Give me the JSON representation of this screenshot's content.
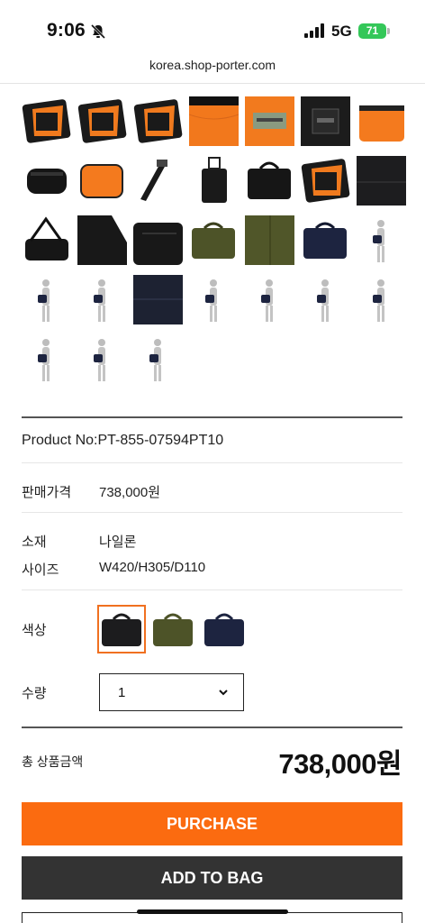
{
  "status_bar": {
    "time": "9:06",
    "network": "5G",
    "battery": "71"
  },
  "browser": {
    "url": "korea.shop-porter.com"
  },
  "gallery": {
    "thumbnails": [
      {
        "name": "thumb-black-open",
        "kind": "black-orange"
      },
      {
        "name": "thumb-black-side",
        "kind": "black-orange"
      },
      {
        "name": "thumb-black-open-2",
        "kind": "black-orange"
      },
      {
        "name": "thumb-orange-lining",
        "kind": "orange"
      },
      {
        "name": "thumb-label",
        "kind": "label"
      },
      {
        "name": "thumb-logo-patch",
        "kind": "patch"
      },
      {
        "name": "thumb-orange-case",
        "kind": "orange-case"
      },
      {
        "name": "thumb-black-pouch",
        "kind": "black-pouch"
      },
      {
        "name": "thumb-orange-pad",
        "kind": "orange-pad"
      },
      {
        "name": "thumb-strap",
        "kind": "strap"
      },
      {
        "name": "thumb-trolley",
        "kind": "trolley"
      },
      {
        "name": "thumb-black-front",
        "kind": "black-bag"
      },
      {
        "name": "thumb-black-inside",
        "kind": "black-orange"
      },
      {
        "name": "thumb-black-fabric",
        "kind": "black-fabric"
      },
      {
        "name": "thumb-black-strap",
        "kind": "black-strap"
      },
      {
        "name": "thumb-black-corner",
        "kind": "black-corner"
      },
      {
        "name": "thumb-black-zip",
        "kind": "black-zip"
      },
      {
        "name": "thumb-olive-front",
        "kind": "olive-bag"
      },
      {
        "name": "thumb-olive-fabric",
        "kind": "olive-fabric"
      },
      {
        "name": "thumb-navy-front",
        "kind": "navy-bag"
      },
      {
        "name": "thumb-model-1",
        "kind": "model"
      },
      {
        "name": "thumb-model-2",
        "kind": "model"
      },
      {
        "name": "thumb-model-3",
        "kind": "model"
      },
      {
        "name": "thumb-navy-fabric",
        "kind": "navy-fabric"
      },
      {
        "name": "thumb-model-4",
        "kind": "model"
      },
      {
        "name": "thumb-model-5",
        "kind": "model"
      },
      {
        "name": "thumb-model-6",
        "kind": "model"
      },
      {
        "name": "thumb-model-7",
        "kind": "model"
      },
      {
        "name": "thumb-model-8",
        "kind": "model"
      },
      {
        "name": "thumb-model-9",
        "kind": "model"
      },
      {
        "name": "thumb-model-10",
        "kind": "model"
      }
    ]
  },
  "product": {
    "product_no": "Product No:PT-855-07594PT10",
    "price_label": "판매가격",
    "price_value": "738,000원",
    "material_label": "소재",
    "material_value": "나일론",
    "size_label": "사이즈",
    "size_value": "W420/H305/D110",
    "color_label": "색상",
    "colors": [
      {
        "name": "black",
        "hex": "#1c1c1e",
        "selected": true
      },
      {
        "name": "olive",
        "hex": "#4d5328",
        "selected": false
      },
      {
        "name": "navy",
        "hex": "#1d2440",
        "selected": false
      }
    ],
    "qty_label": "수량",
    "qty_value": "1"
  },
  "summary": {
    "total_label": "총 상품금액",
    "total_value": "738,000원"
  },
  "actions": {
    "purchase_label": "PURCHASE",
    "add_to_bag_label": "ADD TO BAG"
  },
  "colors": {
    "accent": "#fb6b10",
    "dark_button": "#333333",
    "selected_outline": "#f07020"
  }
}
